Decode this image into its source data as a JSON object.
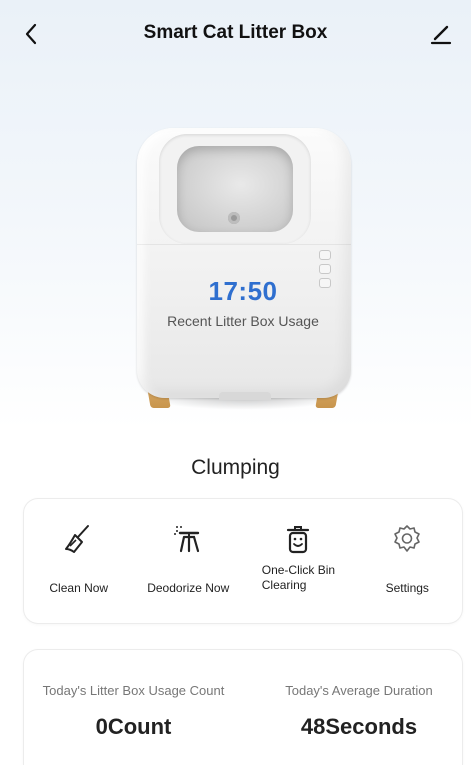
{
  "header": {
    "title": "Smart Cat Litter Box",
    "back_icon": "chevron-left-icon",
    "edit_icon": "pencil-icon"
  },
  "device": {
    "time": "17:50",
    "recent_label": "Recent Litter Box Usage",
    "accent_color": "#2f6fcf"
  },
  "status": "Clumping",
  "actions": [
    {
      "label": "Clean Now",
      "icon": "broom-icon"
    },
    {
      "label": "Deodorize Now",
      "icon": "deodorize-icon"
    },
    {
      "label": "One-Click Bin Clearing",
      "icon": "trash-bin-icon"
    },
    {
      "label": "Settings",
      "icon": "gear-icon"
    }
  ],
  "stats": {
    "usage_count_label": "Today's Litter Box Usage Count",
    "usage_count_value": "0Count",
    "avg_duration_label": "Today's Average Duration",
    "avg_duration_value": "48Seconds"
  }
}
